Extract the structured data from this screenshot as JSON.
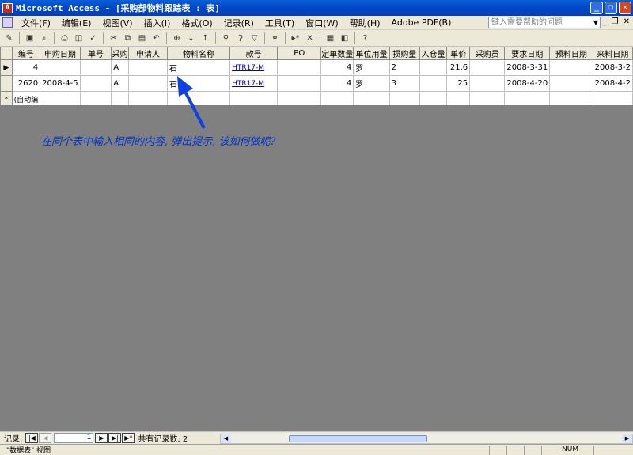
{
  "titlebar": {
    "title": "Microsoft Access - [采购部物料跟踪表 : 表]",
    "app_icon": "access-icon"
  },
  "window_buttons": {
    "minimize": "_",
    "restore": "❐",
    "close": "✕"
  },
  "menubar": {
    "items": [
      "文件(F)",
      "编辑(E)",
      "视图(V)",
      "插入(I)",
      "格式(O)",
      "记录(R)",
      "工具(T)",
      "窗口(W)",
      "帮助(H)",
      "Adobe PDF(B)"
    ],
    "help_placeholder": "键入需要帮助的问题",
    "mdi_buttons": [
      "_",
      "❐",
      "✕"
    ]
  },
  "toolbar": {
    "icons": [
      "view-icon",
      "save-icon",
      "search-file-icon",
      "print-icon",
      "print-preview-icon",
      "spelling-icon",
      "cut-icon",
      "copy-icon",
      "paste-icon",
      "undo-icon",
      "hyperlink-icon",
      "sort-ascending-icon",
      "sort-descending-icon",
      "filter-by-selection-icon",
      "filter-by-form-icon",
      "apply-filter-icon",
      "find-icon",
      "new-record-icon",
      "delete-record-icon",
      "database-window-icon",
      "new-object-icon",
      "help-icon"
    ]
  },
  "table": {
    "columns": [
      "编号",
      "申购日期",
      "单号",
      "采购",
      "申请人",
      "物料名称",
      "款号",
      "PO",
      "定单数量",
      "单位用量",
      "损购量",
      "入仓量",
      "单价",
      "采购员",
      "要求日期",
      "预料日期",
      "来料日期"
    ],
    "rows": [
      {
        "selector": "▶",
        "cells": [
          "4",
          "",
          "",
          "A",
          "",
          "石",
          "HTR17-M",
          "",
          "4",
          "罗",
          "2",
          "",
          "21.6",
          "",
          "2008-3-31",
          "",
          "2008-3-2"
        ]
      },
      {
        "selector": "",
        "cells": [
          "2620",
          "2008-4-5",
          "",
          "A",
          "",
          "石",
          "HTR17-M",
          "",
          "4",
          "罗",
          "3",
          "",
          "25",
          "",
          "2008-4-20",
          "",
          "2008-4-2"
        ]
      },
      {
        "selector": "*",
        "cells": [
          "(自动编",
          "",
          "",
          "",
          "",
          "",
          "",
          "",
          "",
          "",
          "",
          "",
          "",
          "",
          "",
          "",
          ""
        ]
      }
    ]
  },
  "annotation": {
    "text": "在同个表中输入相同的内容, 弹出提示, 该如何做呢?",
    "color": "#0033cc"
  },
  "navigation": {
    "label": "记录:",
    "current_record": "1",
    "count_text": "共有记录数: 2",
    "buttons": [
      "|◀",
      "◀",
      "▶",
      "▶|",
      "▶*"
    ]
  },
  "statusbar": {
    "text": "\"数据表\" 视图",
    "num": "NUM"
  }
}
